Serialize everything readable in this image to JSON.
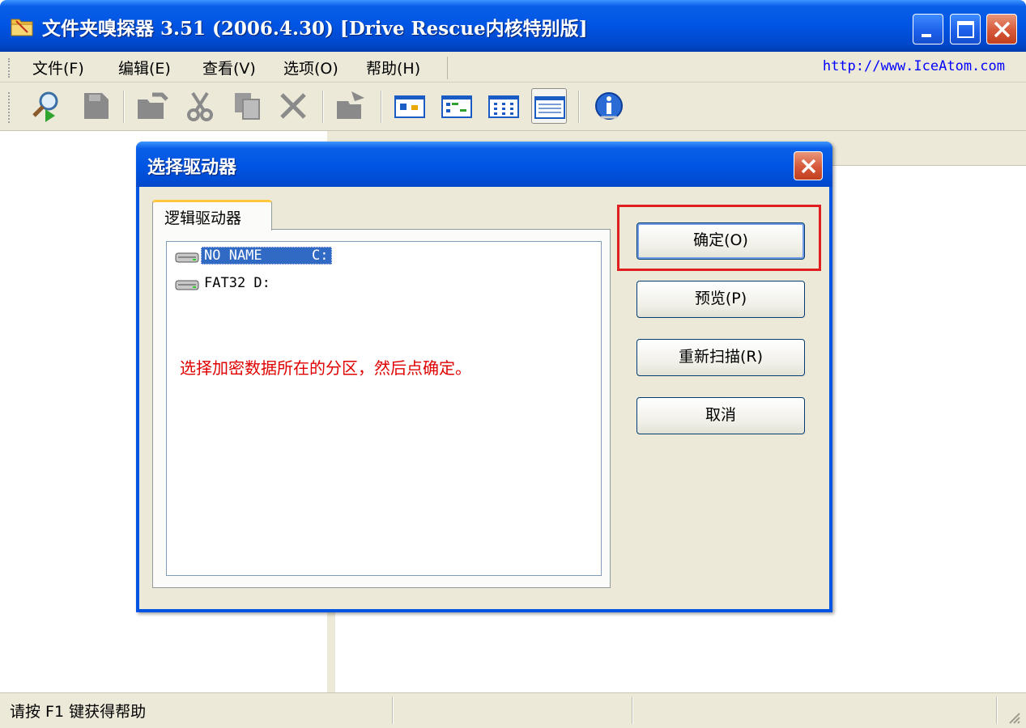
{
  "window": {
    "title": "文件夹嗅探器 3.51 (2006.4.30) [Drive Rescue内核特别版]"
  },
  "menu": {
    "items": [
      {
        "label": "文件(F)"
      },
      {
        "label": "编辑(E)"
      },
      {
        "label": "查看(V)"
      },
      {
        "label": "选项(O)"
      },
      {
        "label": "帮助(H)"
      }
    ],
    "url": "http://www.IceAtom.com"
  },
  "toolbar": {
    "icons": [
      "search-icon",
      "save-icon",
      "folder-icon",
      "cut-icon",
      "copy-icon",
      "delete-icon",
      "move-icon",
      "large-icons-view-icon",
      "small-icons-view-icon",
      "list-view-icon",
      "details-view-icon",
      "about-icon"
    ]
  },
  "dialog": {
    "title": "选择驱动器",
    "tab_label": "逻辑驱动器",
    "drives": [
      {
        "label": "NO NAME      C:",
        "selected": true
      },
      {
        "label": "FAT32 D:",
        "selected": false
      }
    ],
    "hint": "选择加密数据所在的分区，然后点确定。",
    "buttons": {
      "ok": "确定(O)",
      "preview": "预览(P)",
      "rescan": "重新扫描(R)",
      "cancel": "取消"
    }
  },
  "status": {
    "text": "请按 F1 键获得帮助"
  },
  "colors": {
    "title_blue": "#0054e3",
    "face": "#ece9d8",
    "hint_red": "#e00000",
    "selection": "#316ac5",
    "highlight_border": "#e02020"
  }
}
